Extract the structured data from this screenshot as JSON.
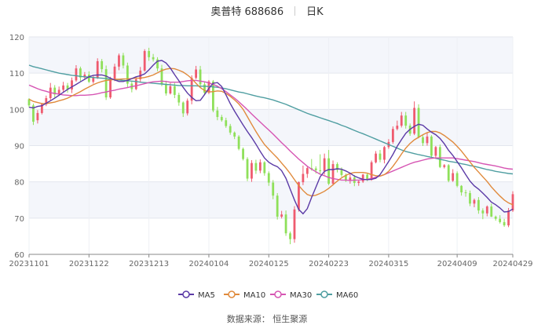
{
  "header": {
    "stock_name": "奥普特 688686",
    "period": "日K"
  },
  "source": "数据来源：  恒生聚源",
  "colors": {
    "up": "#ef5b6f",
    "down": "#8fe05a",
    "ma5": "#5b3aa6",
    "ma10": "#e08a3c",
    "ma30": "#d655b3",
    "ma60": "#4f9ea1",
    "plot_bg": "#f4f6fb"
  },
  "chart_data": {
    "type": "candlestick",
    "y_ticks": [
      "60",
      "70",
      "80",
      "90",
      "100",
      "110",
      "120"
    ],
    "ylim": [
      60,
      120
    ],
    "x_ticks": [
      {
        "i": 0,
        "label": "20231101"
      },
      {
        "i": 14,
        "label": "20231122"
      },
      {
        "i": 28,
        "label": "20231213"
      },
      {
        "i": 42,
        "label": "20240104"
      },
      {
        "i": 56,
        "label": "20240125"
      },
      {
        "i": 70,
        "label": "20240223"
      },
      {
        "i": 84,
        "label": "20240315"
      },
      {
        "i": 100,
        "label": "20240409"
      },
      {
        "i": 113,
        "label": "20240429"
      }
    ],
    "candles": [
      [
        102.8,
        101.1,
        103.1,
        100.5
      ],
      [
        101.1,
        96.6,
        101.6,
        95.7
      ],
      [
        97.0,
        99.0,
        99.8,
        96.1
      ],
      [
        99.0,
        101.4,
        101.8,
        98.6
      ],
      [
        101.4,
        103.1,
        103.8,
        100.9
      ],
      [
        103.1,
        106.0,
        107.3,
        102.6
      ],
      [
        106.0,
        104.1,
        106.7,
        103.3
      ],
      [
        104.1,
        105.4,
        106.3,
        103.7
      ],
      [
        105.4,
        106.6,
        107.6,
        104.7
      ],
      [
        106.6,
        105.5,
        107.3,
        104.6
      ],
      [
        105.5,
        108.0,
        108.8,
        104.5
      ],
      [
        108.0,
        111.3,
        112.2,
        107.6
      ],
      [
        111.3,
        108.8,
        111.8,
        107.8
      ],
      [
        108.8,
        109.6,
        110.3,
        108.2
      ],
      [
        109.6,
        107.6,
        110.5,
        107.3
      ],
      [
        107.6,
        108.7,
        109.3,
        107.1
      ],
      [
        108.7,
        113.3,
        114.1,
        108.4
      ],
      [
        113.3,
        111.1,
        113.9,
        110.2
      ],
      [
        111.1,
        103.3,
        112.1,
        102.6
      ],
      [
        103.3,
        108.3,
        109.0,
        102.9
      ],
      [
        108.3,
        111.8,
        112.6,
        107.8
      ],
      [
        111.8,
        114.9,
        115.4,
        110.8
      ],
      [
        114.9,
        112.1,
        115.6,
        111.3
      ],
      [
        112.1,
        107.1,
        112.9,
        106.1
      ],
      [
        107.1,
        105.6,
        107.9,
        104.7
      ],
      [
        105.6,
        108.3,
        108.9,
        105.3
      ],
      [
        108.3,
        110.7,
        111.7,
        107.5
      ],
      [
        110.7,
        116.1,
        116.6,
        110.4
      ],
      [
        116.1,
        114.4,
        117.0,
        113.4
      ],
      [
        114.4,
        113.8,
        115.3,
        113.2
      ],
      [
        113.8,
        111.3,
        114.4,
        110.5
      ],
      [
        111.3,
        107.0,
        112.3,
        106.4
      ],
      [
        107.0,
        104.4,
        107.9,
        103.8
      ],
      [
        104.4,
        106.4,
        107.3,
        104.1
      ],
      [
        106.4,
        104.0,
        107.3,
        103.1
      ],
      [
        104.0,
        101.9,
        104.6,
        101.0
      ],
      [
        101.9,
        98.9,
        102.2,
        97.9
      ],
      [
        98.9,
        102.4,
        103.0,
        98.3
      ],
      [
        102.4,
        108.7,
        109.4,
        101.4
      ],
      [
        108.7,
        111.0,
        112.0,
        108.3
      ],
      [
        111.0,
        106.9,
        112.0,
        105.9
      ],
      [
        106.9,
        104.6,
        107.7,
        104.2
      ],
      [
        104.6,
        107.7,
        108.1,
        104.2
      ],
      [
        107.7,
        99.7,
        108.1,
        99.2
      ],
      [
        99.7,
        97.9,
        100.7,
        97.0
      ],
      [
        97.9,
        97.0,
        98.5,
        96.6
      ],
      [
        97.0,
        95.4,
        97.7,
        94.9
      ],
      [
        95.4,
        93.6,
        96.0,
        93.0
      ],
      [
        93.6,
        92.5,
        93.9,
        91.8
      ],
      [
        92.5,
        89.1,
        92.9,
        88.7
      ],
      [
        89.1,
        86.3,
        89.5,
        85.9
      ],
      [
        86.3,
        80.9,
        86.8,
        80.2
      ],
      [
        80.9,
        85.2,
        86.0,
        80.0
      ],
      [
        85.2,
        83.1,
        86.1,
        82.2
      ],
      [
        83.1,
        85.4,
        86.2,
        82.4
      ],
      [
        85.4,
        82.4,
        85.7,
        81.7
      ],
      [
        82.4,
        79.8,
        82.9,
        78.9
      ],
      [
        79.8,
        76.2,
        80.5,
        75.2
      ],
      [
        76.2,
        70.4,
        76.9,
        69.6
      ],
      [
        70.4,
        71.0,
        72.0,
        69.9
      ],
      [
        71.0,
        65.8,
        72.1,
        65.1
      ],
      [
        65.8,
        64.2,
        66.3,
        62.8
      ],
      [
        64.2,
        72.4,
        73.3,
        63.2
      ],
      [
        72.4,
        79.9,
        80.1,
        71.8
      ],
      [
        79.9,
        82.2,
        84.5,
        79.1
      ],
      [
        82.2,
        83.8,
        84.2,
        81.1
      ],
      [
        83.8,
        83.7,
        86.3,
        83.1
      ],
      [
        83.7,
        83.2,
        84.3,
        82.3
      ],
      [
        83.2,
        83.0,
        87.6,
        82.3
      ],
      [
        83.0,
        86.5,
        87.8,
        82.0
      ],
      [
        86.5,
        79.5,
        88.8,
        79.1
      ],
      [
        79.5,
        84.9,
        85.9,
        79.0
      ],
      [
        84.9,
        83.3,
        85.4,
        82.6
      ],
      [
        83.3,
        81.9,
        84.0,
        81.4
      ],
      [
        81.9,
        80.3,
        82.3,
        80.0
      ],
      [
        80.3,
        81.2,
        82.3,
        79.5
      ],
      [
        81.2,
        79.7,
        81.9,
        78.8
      ],
      [
        79.7,
        80.1,
        80.5,
        78.9
      ],
      [
        80.1,
        82.0,
        82.2,
        79.7
      ],
      [
        82.0,
        80.6,
        82.3,
        80.2
      ],
      [
        80.6,
        85.4,
        85.9,
        80.3
      ],
      [
        85.4,
        87.8,
        88.5,
        85.1
      ],
      [
        87.8,
        86.1,
        88.8,
        85.4
      ],
      [
        86.1,
        89.6,
        89.9,
        85.1
      ],
      [
        89.6,
        91.0,
        91.8,
        89.1
      ],
      [
        91.0,
        94.6,
        95.3,
        90.5
      ],
      [
        94.6,
        95.5,
        96.9,
        94.2
      ],
      [
        95.5,
        98.3,
        99.3,
        95.0
      ],
      [
        98.3,
        95.5,
        99.3,
        94.7
      ],
      [
        95.5,
        93.3,
        96.1,
        92.7
      ],
      [
        93.3,
        100.4,
        102.2,
        92.9
      ],
      [
        100.4,
        92.3,
        101.4,
        92.0
      ],
      [
        92.3,
        90.7,
        92.8,
        89.9
      ],
      [
        90.7,
        92.5,
        93.5,
        90.0
      ],
      [
        92.5,
        87.2,
        92.9,
        86.5
      ],
      [
        87.2,
        89.6,
        89.9,
        86.6
      ],
      [
        89.6,
        84.1,
        90.3,
        83.8
      ],
      [
        84.1,
        84.6,
        84.9,
        83.7
      ],
      [
        84.6,
        80.3,
        84.9,
        79.9
      ],
      [
        80.3,
        82.4,
        83.5,
        80.0
      ],
      [
        82.4,
        78.9,
        82.9,
        78.5
      ],
      [
        78.9,
        77.1,
        79.1,
        76.2
      ],
      [
        77.1,
        76.9,
        77.8,
        75.9
      ],
      [
        76.9,
        74.0,
        77.6,
        73.3
      ],
      [
        74.0,
        75.0,
        75.4,
        73.0
      ],
      [
        75.0,
        72.1,
        75.8,
        71.2
      ],
      [
        72.1,
        71.3,
        72.7,
        69.7
      ],
      [
        71.3,
        73.2,
        73.5,
        70.5
      ],
      [
        73.2,
        70.4,
        74.0,
        70.3
      ],
      [
        70.4,
        69.8,
        70.7,
        69.3
      ],
      [
        69.8,
        68.9,
        70.8,
        68.5
      ],
      [
        68.9,
        68.0,
        69.8,
        67.6
      ],
      [
        68.0,
        72.1,
        72.8,
        67.5
      ],
      [
        72.1,
        76.6,
        77.4,
        71.7
      ]
    ],
    "legend": [
      "MA5",
      "MA10",
      "MA30",
      "MA60"
    ],
    "ma5_label": "MA5",
    "ma10_label": "MA10",
    "ma30_label": "MA30",
    "ma60_label": "MA60",
    "ma5": [
      100.6,
      100.4,
      100.8,
      101.0,
      101.7,
      102.4,
      103.1,
      103.9,
      104.7,
      105.5,
      106.2,
      106.9,
      107.6,
      108.3,
      109.0,
      109.4,
      109.5,
      109.5,
      109.2,
      108.6,
      108.1,
      107.7,
      107.7,
      108.0,
      108.5,
      109.0,
      109.3,
      109.8,
      110.9,
      112.2,
      113.3,
      113.5,
      112.8,
      111.4,
      109.6,
      107.9,
      106.1,
      104.5,
      103.3,
      102.4,
      102.5,
      104.1,
      105.8,
      107.2,
      107.4,
      106.3,
      104.0,
      101.6,
      99.5,
      97.6,
      95.7,
      93.9,
      92.2,
      90.4,
      88.4,
      86.6,
      85.4,
      84.7,
      84.2,
      83.1,
      81.0,
      78.0,
      75.0,
      72.4,
      71.2,
      72.6,
      75.7,
      78.5,
      81.4,
      82.9,
      83.4,
      83.4,
      83.6,
      83.5,
      83.0,
      82.4,
      81.6,
      81.1,
      80.7,
      80.6,
      80.7,
      81.0,
      82.0,
      83.8,
      85.6,
      87.6,
      89.8,
      91.7,
      93.4,
      94.5,
      95.3,
      95.9,
      95.6,
      94.6,
      93.7,
      93.0,
      92.0,
      90.5,
      88.7,
      87.3,
      85.6,
      83.9,
      82.0,
      80.2,
      78.9,
      78.0,
      76.9,
      75.7,
      74.4,
      73.7,
      72.8,
      71.7,
      71.8,
      72.5
    ],
    "ma10": [
      102.8,
      102.2,
      101.9,
      101.6,
      101.6,
      101.8,
      102.0,
      102.4,
      102.7,
      103.1,
      103.7,
      104.3,
      104.9,
      105.6,
      106.2,
      106.8,
      107.3,
      107.7,
      108.0,
      108.1,
      108.3,
      108.3,
      108.4,
      108.4,
      108.5,
      108.6,
      108.6,
      108.8,
      109.1,
      109.5,
      110.1,
      110.7,
      111.1,
      111.3,
      111.2,
      110.8,
      110.3,
      109.5,
      108.5,
      107.2,
      106.0,
      105.2,
      104.8,
      104.9,
      105.1,
      105.0,
      104.4,
      103.6,
      102.6,
      101.5,
      100.0,
      98.0,
      95.9,
      93.9,
      92.0,
      90.3,
      89.0,
      87.8,
      86.6,
      85.2,
      83.8,
      82.3,
      80.6,
      79.0,
      77.6,
      76.5,
      76.1,
      76.3,
      76.8,
      77.4,
      78.2,
      79.2,
      80.2,
      81.1,
      81.8,
      82.3,
      82.6,
      82.6,
      82.6,
      82.4,
      82.0,
      81.7,
      81.6,
      82.0,
      82.9,
      84.3,
      85.9,
      87.7,
      89.3,
      90.6,
      91.6,
      92.3,
      93.0,
      93.6,
      93.9,
      93.9,
      93.5,
      92.8,
      91.9,
      91.0,
      89.8,
      88.5,
      87.0,
      85.5,
      84.0,
      82.7,
      81.4,
      80.1,
      78.6,
      77.3,
      76.1,
      75.0,
      74.2,
      73.7
    ],
    "ma30": [
      106.7,
      106.2,
      105.7,
      105.3,
      105.0,
      104.6,
      104.4,
      104.2,
      104.0,
      103.9,
      103.8,
      103.8,
      103.9,
      103.9,
      104.0,
      104.1,
      104.3,
      104.6,
      104.8,
      105.1,
      105.3,
      105.6,
      105.8,
      106.0,
      106.3,
      106.5,
      106.8,
      107.1,
      107.4,
      107.6,
      107.7,
      107.8,
      107.7,
      107.5,
      107.5,
      107.5,
      107.7,
      107.9,
      108.0,
      108.0,
      107.8,
      107.6,
      107.3,
      106.9,
      106.4,
      105.7,
      104.9,
      104.0,
      103.1,
      102.1,
      101.0,
      99.9,
      98.7,
      97.6,
      96.5,
      95.4,
      94.3,
      93.2,
      92.0,
      90.8,
      89.7,
      88.5,
      87.4,
      86.3,
      85.3,
      84.3,
      83.5,
      82.8,
      82.1,
      81.7,
      81.2,
      80.9,
      80.7,
      80.5,
      80.5,
      80.4,
      80.5,
      80.5,
      80.6,
      80.7,
      80.9,
      81.3,
      81.6,
      82.0,
      82.5,
      83.0,
      83.5,
      84.0,
      84.5,
      85.0,
      85.4,
      85.7,
      86.0,
      86.3,
      86.5,
      86.6,
      86.6,
      86.6,
      86.6,
      86.6,
      86.4,
      86.2,
      86.0,
      85.8,
      85.6,
      85.3,
      85.0,
      84.8,
      84.6,
      84.4,
      84.1,
      83.8,
      83.6,
      83.5
    ],
    "ma60": [
      112.2,
      111.8,
      111.5,
      111.2,
      110.9,
      110.6,
      110.3,
      110.0,
      109.8,
      109.6,
      109.4,
      109.3,
      109.1,
      109.0,
      108.9,
      108.8,
      108.7,
      108.6,
      108.5,
      108.3,
      108.2,
      108.1,
      108.0,
      107.9,
      107.8,
      107.7,
      107.5,
      107.4,
      107.3,
      107.2,
      107.1,
      107.0,
      106.9,
      106.8,
      106.7,
      106.6,
      106.6,
      106.5,
      106.5,
      106.5,
      106.4,
      106.4,
      106.3,
      106.2,
      106.1,
      105.9,
      105.7,
      105.4,
      105.1,
      104.8,
      104.6,
      104.3,
      104.0,
      103.7,
      103.4,
      103.2,
      102.9,
      102.6,
      102.2,
      101.8,
      101.4,
      100.9,
      100.4,
      99.9,
      99.4,
      98.9,
      98.5,
      98.1,
      97.7,
      97.3,
      96.9,
      96.5,
      96.1,
      95.6,
      95.2,
      94.7,
      94.2,
      93.7,
      93.3,
      92.8,
      92.3,
      91.8,
      91.3,
      90.8,
      90.3,
      89.8,
      89.3,
      88.8,
      88.4,
      88.1,
      87.8,
      87.5,
      87.3,
      87.0,
      86.8,
      86.5,
      86.2,
      86.0,
      85.7,
      85.5,
      85.3,
      85.0,
      84.8,
      84.5,
      84.3,
      84.0,
      83.7,
      83.4,
      83.2,
      82.9,
      82.7,
      82.5,
      82.3,
      82.2
    ]
  }
}
